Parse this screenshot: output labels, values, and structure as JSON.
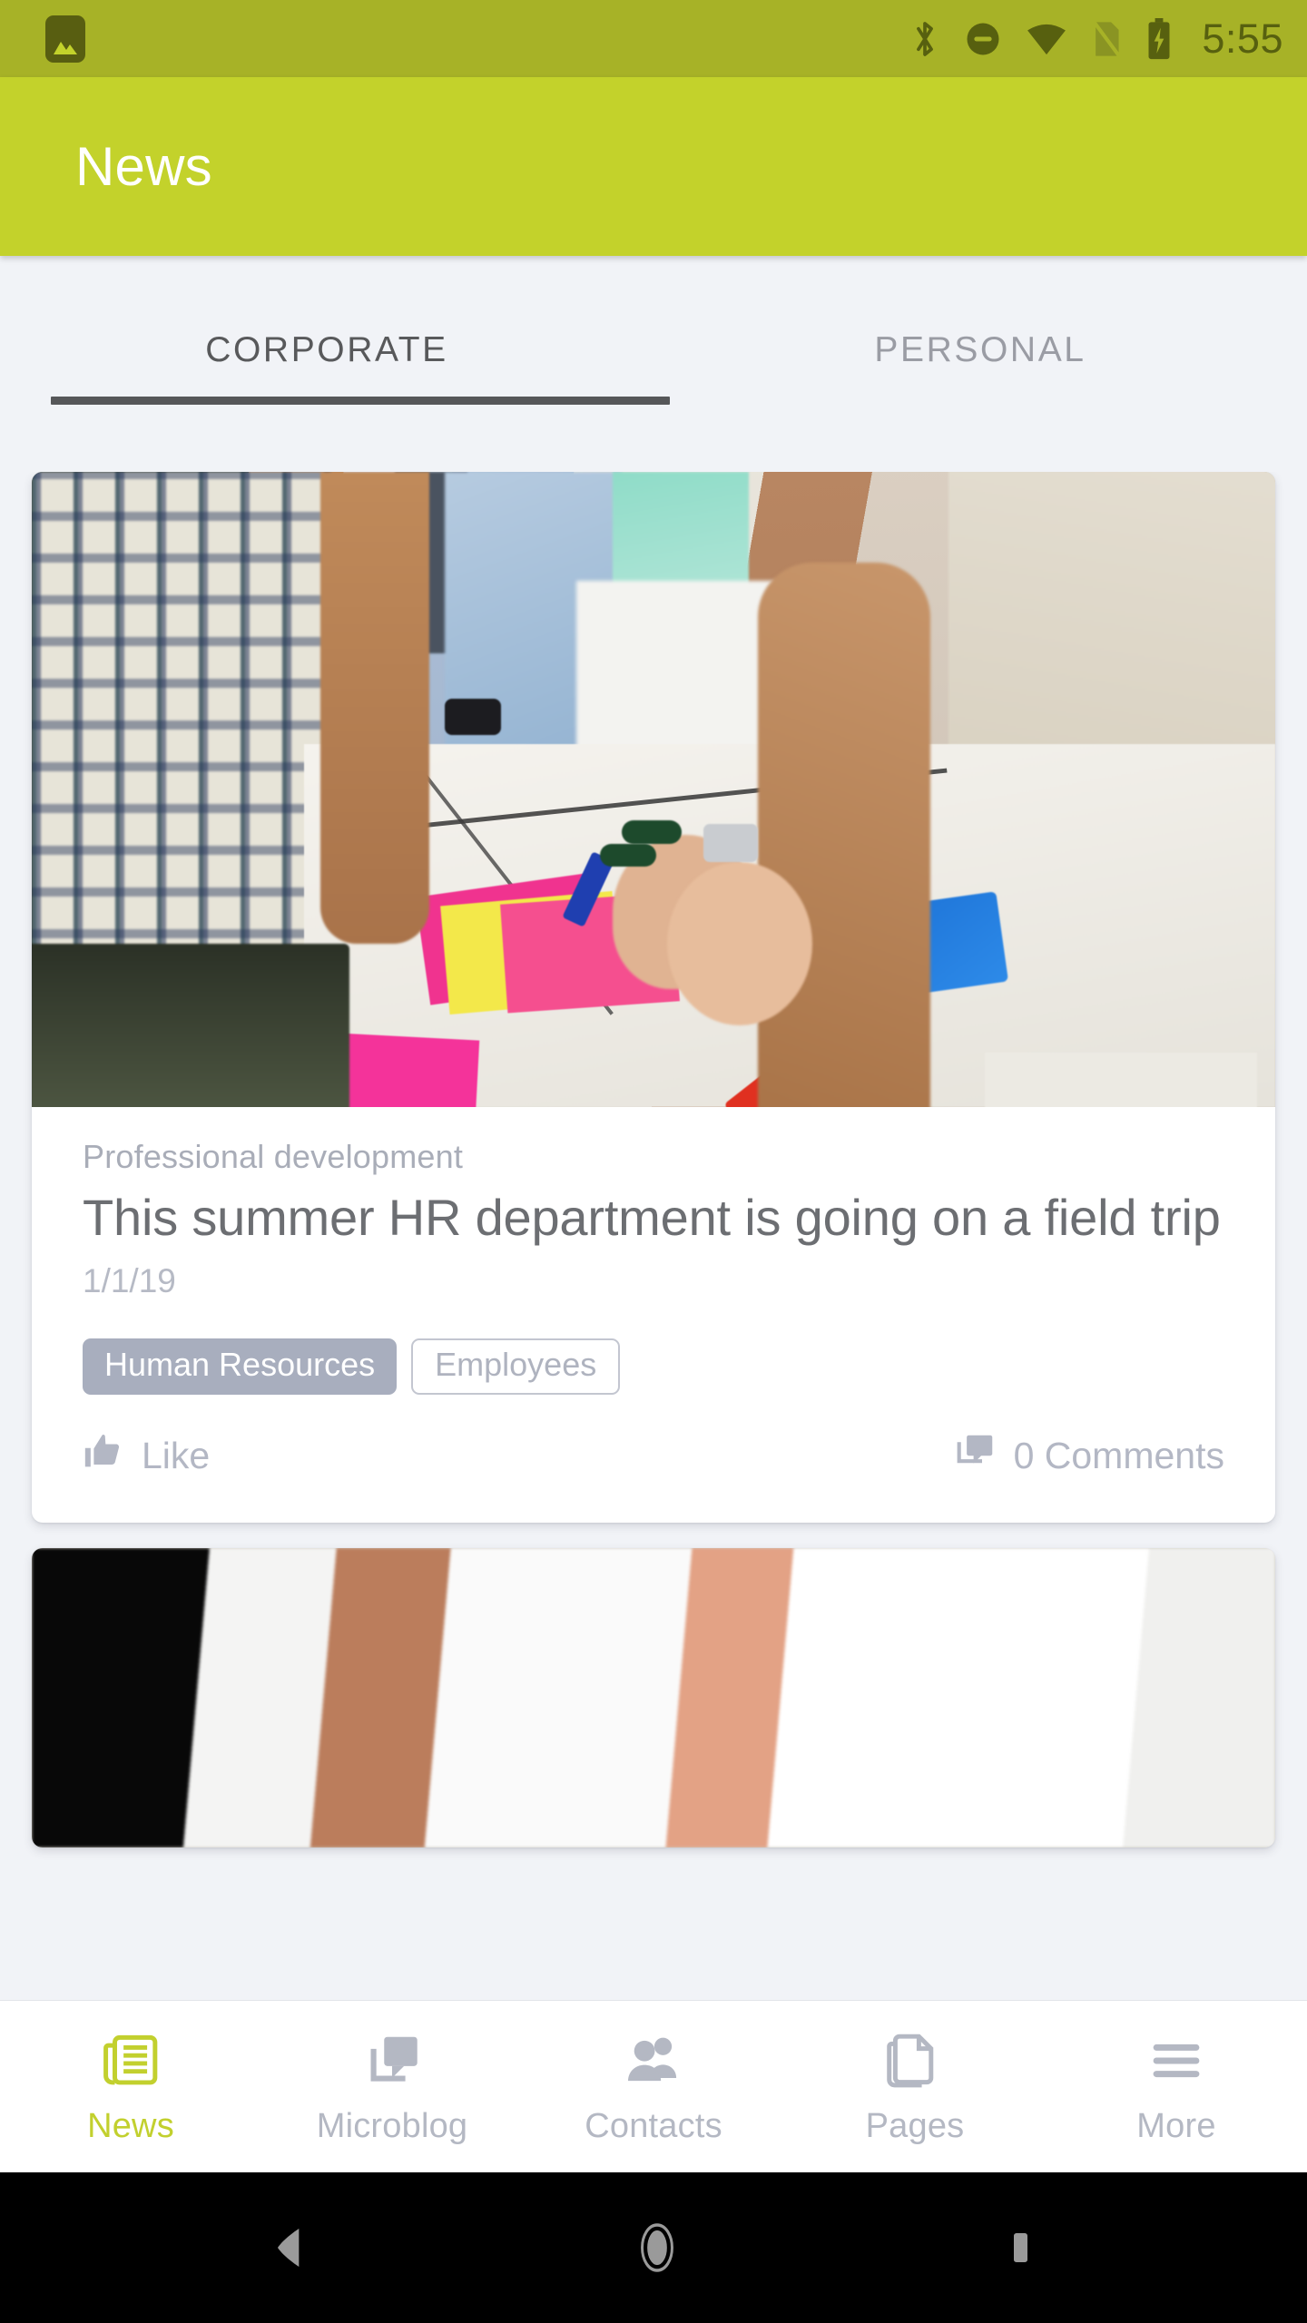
{
  "statusbar": {
    "notification_icon": "image-notification-icon",
    "icons": [
      "bluetooth-icon",
      "do-not-disturb-icon",
      "wifi-icon",
      "no-sim-icon",
      "battery-charging-icon"
    ],
    "time": "5:55"
  },
  "appbar": {
    "title": "News",
    "background": "#C3D22B"
  },
  "tabs": [
    {
      "label": "CORPORATE",
      "active": true
    },
    {
      "label": "PERSONAL",
      "active": false
    }
  ],
  "feed": {
    "cards": [
      {
        "category": "Professional development",
        "headline": "This summer HR department is going on a field trip",
        "date": "1/1/19",
        "tags": [
          {
            "label": "Human Resources",
            "style": "filled"
          },
          {
            "label": "Employees",
            "style": "outline"
          }
        ],
        "like_label": "Like",
        "comments_label": "0 Comments",
        "like_icon": "thumbs-up-icon",
        "comments_icon": "comment-icon"
      },
      {
        "partial": true
      }
    ]
  },
  "bottomnav": {
    "active_color": "#C2D02E",
    "inactive_color": "#B4B8C3",
    "items": [
      {
        "label": "News",
        "icon": "newspaper-icon",
        "active": true
      },
      {
        "label": "Microblog",
        "icon": "chat-bubble-icon",
        "active": false
      },
      {
        "label": "Contacts",
        "icon": "people-icon",
        "active": false
      },
      {
        "label": "Pages",
        "icon": "document-icon",
        "active": false
      },
      {
        "label": "More",
        "icon": "hamburger-menu-icon",
        "active": false
      }
    ]
  },
  "sysnav": {
    "buttons": [
      {
        "name": "back-button",
        "icon": "triangle-back-icon"
      },
      {
        "name": "home-button",
        "icon": "circle-home-icon"
      },
      {
        "name": "recents-button",
        "icon": "square-recents-icon"
      }
    ]
  }
}
